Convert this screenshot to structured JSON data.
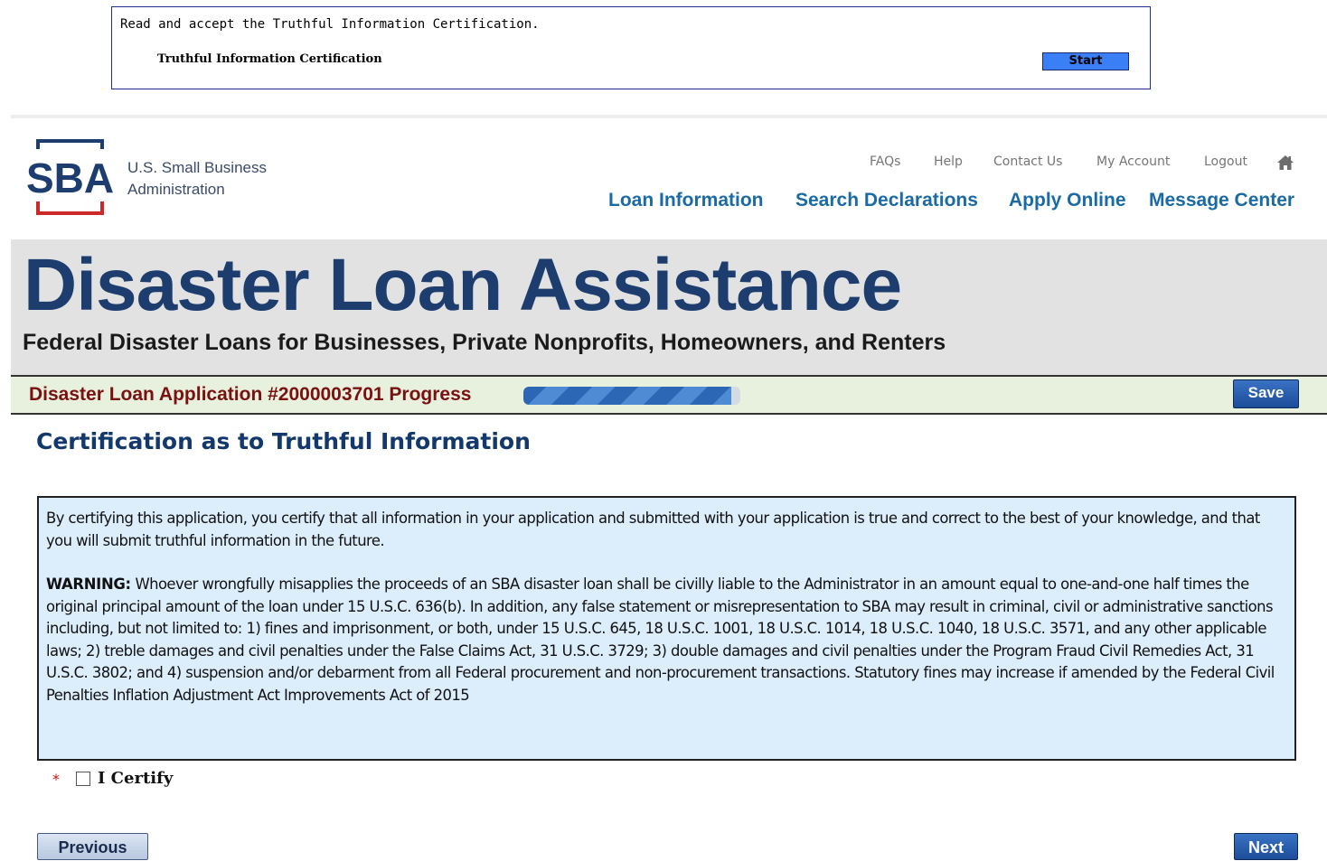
{
  "tic": {
    "instruction": "Read and accept the Truthful Information Certification.",
    "label": "Truthful Information Certification",
    "start_label": "Start",
    "start_color": "#3a7ff5"
  },
  "header": {
    "logo_mark": "SBA",
    "logo_line1": "U.S. Small Business",
    "logo_line2": "Administration",
    "util_links": [
      "FAQs",
      "Help",
      "Contact Us",
      "My Account",
      "Logout"
    ],
    "home_icon": "home-icon",
    "main_nav": [
      "Loan Information",
      "Search Declarations",
      "Apply Online",
      "Message Center"
    ]
  },
  "banner": {
    "title": "Disaster Loan Assistance",
    "subtitle": "Federal Disaster Loans for Businesses, Private Nonprofits, Homeowners, and Renters"
  },
  "progress": {
    "label": "Disaster Loan Application #2000003701  Progress",
    "fraction": 0.96,
    "save_label": "Save"
  },
  "page": {
    "title": "Certification as to Truthful Information"
  },
  "certification": {
    "paragraph1": "By certifying this application, you certify that all information in your application and submitted with your application is true and correct to the best of your knowledge, and that you will submit truthful information in the future.",
    "warning_label": "WARNING:",
    "warning_text": " Whoever wrongfully misapplies the proceeds of an SBA disaster loan shall be civilly liable to the Administrator in an amount equal to one-and-one half times the original principal amount of the loan under 15 U.S.C. 636(b). In addition, any false statement or misrepresentation to SBA may result in criminal, civil or administrative sanctions including, but not limited to: 1) fines and imprisonment, or both, under 15 U.S.C. 645, 18 U.S.C. 1001, 18 U.S.C. 1014, 18 U.S.C. 1040, 18 U.S.C. 3571, and any other applicable laws; 2) treble damages and civil penalties under the False Claims Act, 31 U.S.C. 3729; 3) double damages and civil penalties under the Program Fraud Civil Remedies Act, 31 U.S.C. 3802; and 4) suspension and/or debarment from all Federal procurement and non-procurement transactions. Statutory fines may increase if amended by the Federal Civil Penalties Inflation Adjustment Act Improvements Act of 2015",
    "certify_label": "I Certify",
    "certify_checked": false,
    "required_mark": "*"
  },
  "footer": {
    "previous_label": "Previous",
    "next_label": "Next"
  }
}
